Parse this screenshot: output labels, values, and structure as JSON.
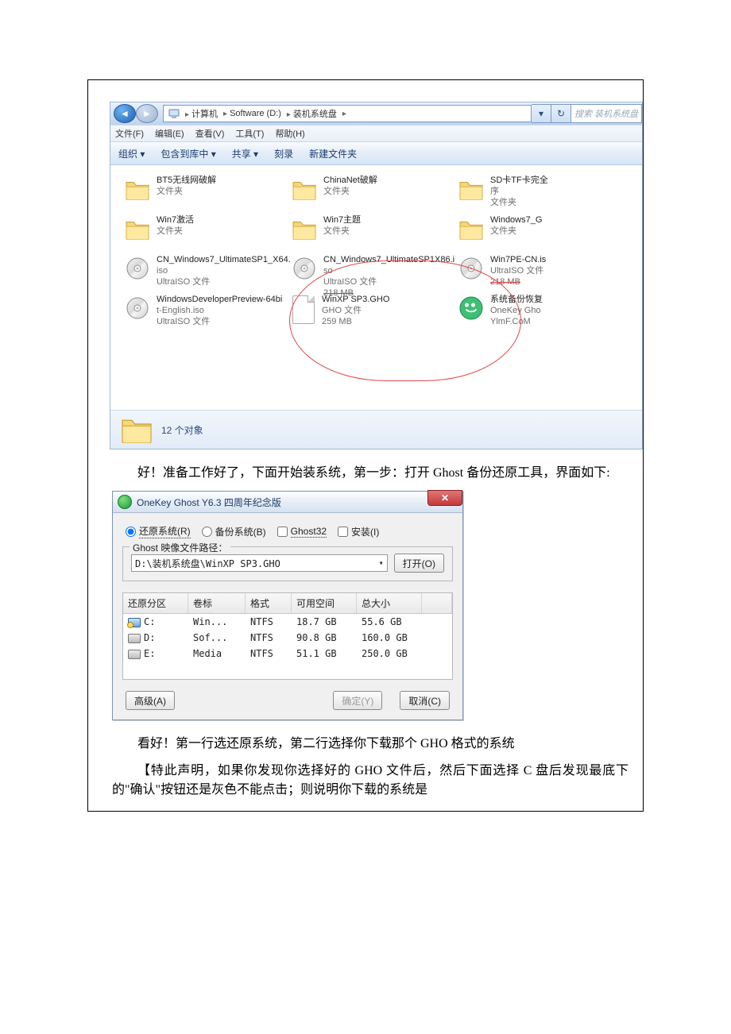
{
  "explorer": {
    "breadcrumb": [
      "计算机",
      "Software (D:)",
      "装机系统盘"
    ],
    "search_placeholder": "搜索 装机系统盘",
    "menus": [
      "文件(F)",
      "编辑(E)",
      "查看(V)",
      "工具(T)",
      "帮助(H)"
    ],
    "toolbar": {
      "organize": "组织 ▾",
      "include": "包含到库中 ▾",
      "share": "共享 ▾",
      "burn": "刻录",
      "newfolder": "新建文件夹"
    },
    "files": [
      {
        "icon": "folder",
        "l1": "BT5无线网破解",
        "l2": "文件夹",
        "l3": ""
      },
      {
        "icon": "folder",
        "l1": "ChinaNet破解",
        "l2": "文件夹",
        "l3": ""
      },
      {
        "icon": "folder",
        "l1": "SD卡TF卡完全",
        "l2": "序",
        "l3": "文件夹"
      },
      {
        "icon": "folder",
        "l1": "Win7激活",
        "l2": "文件夹",
        "l3": ""
      },
      {
        "icon": "folder-theme",
        "l1": "Win7主题",
        "l2": "文件夹",
        "l3": ""
      },
      {
        "icon": "folder",
        "l1": "Windows7_G",
        "l2": "文件夹",
        "l3": ""
      },
      {
        "icon": "disc",
        "l1": "CN_Windows7_UltimateSP1_X64.",
        "l2": "iso",
        "l3": "UltraISO 文件"
      },
      {
        "icon": "disc",
        "l1": "CN_Windows7_UltimateSP1X86.i",
        "l2": "so",
        "l3": "UltraISO 文件",
        "strike": "218 MB"
      },
      {
        "icon": "disc",
        "l1": "Win7PE-CN.is",
        "l2": "UltraISO 文件",
        "l3": "218 MB",
        "l3strike": true
      },
      {
        "icon": "disc",
        "l1": "WindowsDeveloperPreview-64bi",
        "l2": "t-English.iso",
        "l3": "UltraISO 文件"
      },
      {
        "icon": "file",
        "l1": "WinXP SP3.GHO",
        "l2": "GHO 文件",
        "l3": "259 MB"
      },
      {
        "icon": "onekey",
        "l1": "系统备份恢复",
        "l2": "OneKey Gho",
        "l3": "YlmF.CoM"
      }
    ],
    "status": "12 个对象"
  },
  "para1": "好！准备工作好了，下面开始装系统，第一步：打开 Ghost 备份还原工具，界面如下:",
  "ghost": {
    "title": "OneKey Ghost Y6.3 四周年纪念版",
    "radio_restore": "还原系统(R)",
    "radio_backup": "备份系统(B)",
    "chk_ghost32": "Ghost32",
    "chk_install": "安装(I)",
    "legend": "Ghost 映像文件路径：",
    "path_value": "D:\\装机系统盘\\WinXP SP3.GHO",
    "btn_open": "打开(O)",
    "columns": [
      "还原分区",
      "卷标",
      "格式",
      "可用空间",
      "总大小"
    ],
    "rows": [
      {
        "drv": "C:",
        "icon": "c",
        "label": "Win...",
        "fs": "NTFS",
        "free": "18.7 GB",
        "total": "55.6 GB"
      },
      {
        "drv": "D:",
        "icon": "hd",
        "label": "Sof...",
        "fs": "NTFS",
        "free": "90.8 GB",
        "total": "160.0 GB"
      },
      {
        "drv": "E:",
        "icon": "hd",
        "label": "Media",
        "fs": "NTFS",
        "free": "51.1 GB",
        "total": "250.0 GB"
      }
    ],
    "btn_adv": "高级(A)",
    "btn_ok": "确定(Y)",
    "btn_cancel": "取消(C)"
  },
  "para2": "看好！第一行选还原系统，第二行选择你下载那个 GHO 格式的系统",
  "para3": "【特此声明，如果你发现你选择好的 GHO 文件后，然后下面选择 C 盘后发现最底下的\"确认\"按钮还是灰色不能点击；则说明你下载的系统是"
}
